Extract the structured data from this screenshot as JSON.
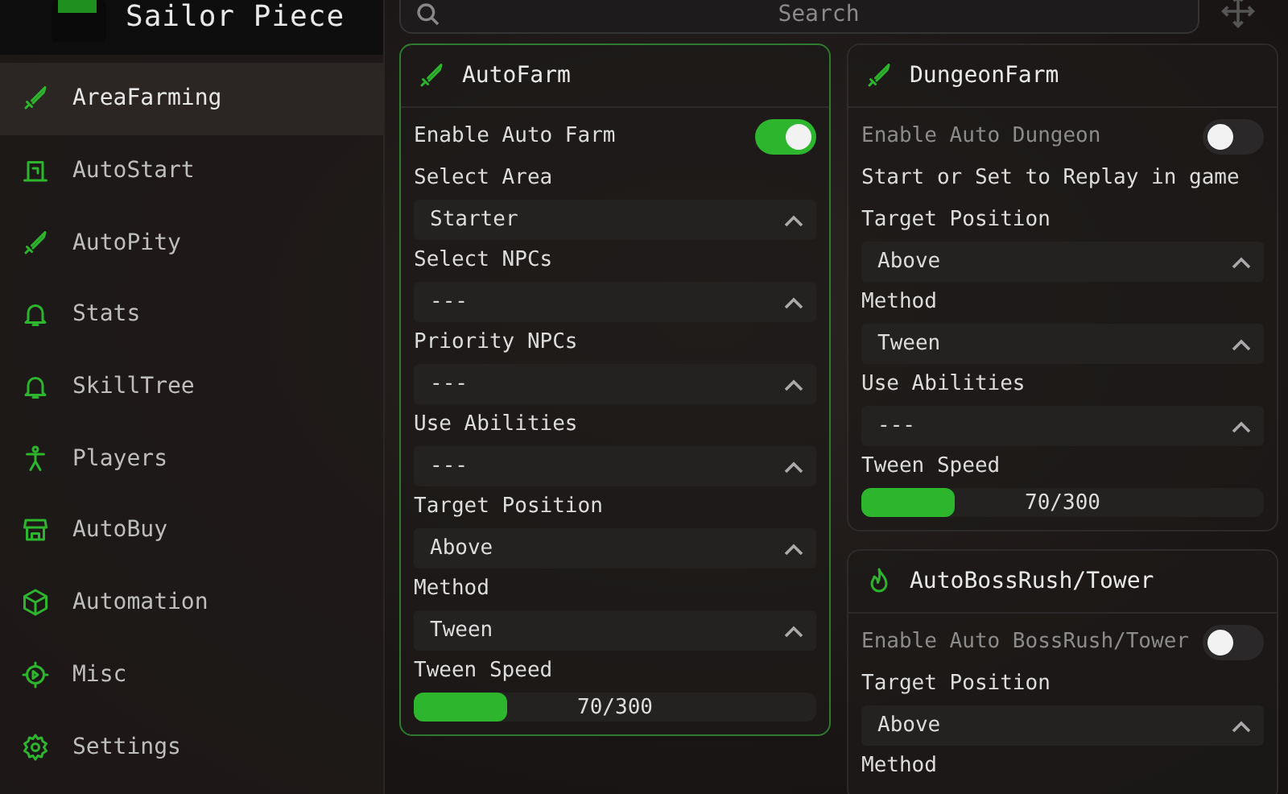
{
  "header": {
    "title": "Sailor Piece"
  },
  "search": {
    "placeholder": "Search"
  },
  "sidebar": {
    "items": [
      {
        "label": "AreaFarming",
        "selected": true
      },
      {
        "label": "AutoStart",
        "selected": false
      },
      {
        "label": "AutoPity",
        "selected": false
      },
      {
        "label": "Stats",
        "selected": false
      },
      {
        "label": "SkillTree",
        "selected": false
      },
      {
        "label": "Players",
        "selected": false
      },
      {
        "label": "AutoBuy",
        "selected": false
      },
      {
        "label": "Automation",
        "selected": false
      },
      {
        "label": "Misc",
        "selected": false
      },
      {
        "label": "Settings",
        "selected": false
      }
    ]
  },
  "columns": [
    {
      "sections": [
        {
          "title": "AutoFarm",
          "active": true,
          "items": [
            {
              "kind": "toggle",
              "label": "Enable Auto Farm",
              "on": true
            },
            {
              "kind": "dropdown",
              "label": "Select Area",
              "value": "Starter"
            },
            {
              "kind": "dropdown",
              "label": "Select NPCs",
              "value": "---"
            },
            {
              "kind": "dropdown",
              "label": "Priority NPCs",
              "value": "---"
            },
            {
              "kind": "dropdown",
              "label": "Use Abilities",
              "value": "---"
            },
            {
              "kind": "dropdown",
              "label": "Target Position",
              "value": "Above"
            },
            {
              "kind": "dropdown",
              "label": "Method",
              "value": "Tween"
            },
            {
              "kind": "slider",
              "label": "Tween Speed",
              "reading": "70/300",
              "level": 0.23
            }
          ]
        }
      ]
    },
    {
      "sections": [
        {
          "title": "DungeonFarm",
          "active": false,
          "items": [
            {
              "kind": "toggle",
              "label": "Enable Auto Dungeon",
              "on": false
            },
            {
              "kind": "note",
              "label": "Start or Set to Replay in game"
            },
            {
              "kind": "dropdown",
              "label": "Target Position",
              "value": "Above"
            },
            {
              "kind": "dropdown",
              "label": "Method",
              "value": "Tween"
            },
            {
              "kind": "dropdown",
              "label": "Use Abilities",
              "value": "---"
            },
            {
              "kind": "slider",
              "label": "Tween Speed",
              "reading": "70/300",
              "level": 0.23
            }
          ]
        },
        {
          "title": "AutoBossRush/Tower",
          "active": false,
          "items": [
            {
              "kind": "toggle",
              "label": "Enable Auto BossRush/Tower",
              "on": false
            },
            {
              "kind": "dropdown",
              "label": "Target Position",
              "value": "Above"
            },
            {
              "kind": "note",
              "label": "Method"
            }
          ]
        }
      ]
    }
  ]
}
